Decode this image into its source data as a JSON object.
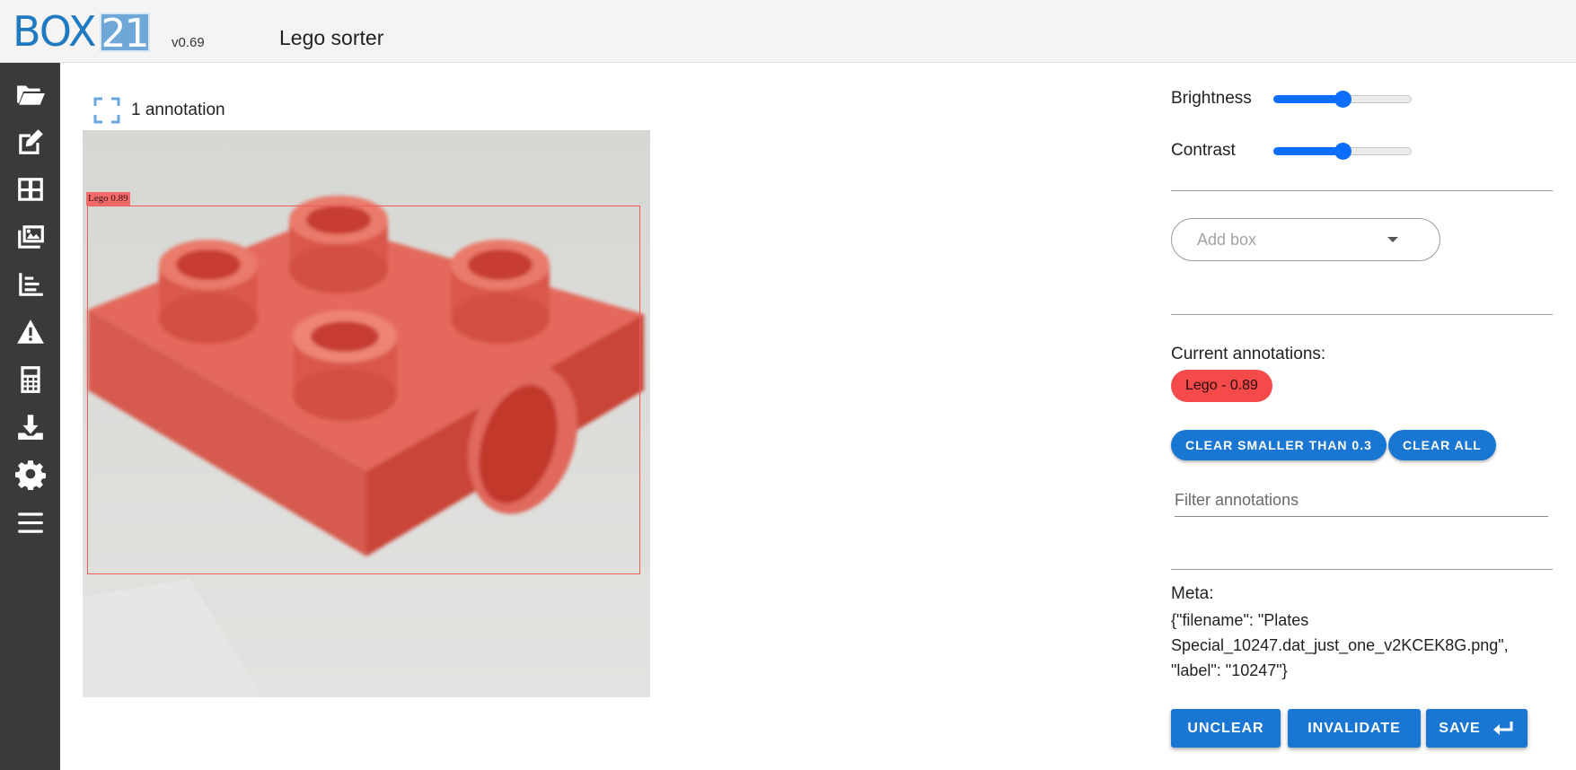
{
  "header": {
    "logo_text": "BOX",
    "logo_number": "21",
    "version": "v0.69",
    "title": "Lego sorter",
    "logo_colors": {
      "box": "#1f7ac2",
      "number_bg": "#6fa7d8"
    }
  },
  "sidebar": {
    "items": [
      {
        "name": "folder-open-icon"
      },
      {
        "name": "edit-icon"
      },
      {
        "name": "grid-icon"
      },
      {
        "name": "images-icon"
      },
      {
        "name": "chart-icon"
      },
      {
        "name": "warning-icon"
      },
      {
        "name": "calculator-icon"
      },
      {
        "name": "download-icon"
      },
      {
        "name": "settings-icon"
      },
      {
        "name": "menu-icon"
      }
    ]
  },
  "main": {
    "annotation_count": "1 annotation",
    "image": {
      "description_icon": "focus-icon",
      "bbox_label": "Lego 0.89",
      "bbox_color": "#f05a5a"
    }
  },
  "panel": {
    "brightness_label": "Brightness",
    "brightness_value": 0.5,
    "contrast_label": "Contrast",
    "contrast_value": 0.5,
    "add_box_placeholder": "Add box",
    "current_annotations_label": "Current annotations:",
    "annotations": [
      {
        "label": "Lego - 0.89",
        "color": "#f44a4a"
      }
    ],
    "clear_smaller_label": "CLEAR SMALLER THAN 0.3",
    "clear_all_label": "CLEAR ALL",
    "filter_placeholder": "Filter annotations",
    "meta_label": "Meta:",
    "meta_value": "{\"filename\": \"Plates Special_10247.dat_just_one_v2KCEK8G.png\", \"label\": \"10247\"}",
    "unclear_label": "UNCLEAR",
    "invalidate_label": "INVALIDATE",
    "save_label": "SAVE",
    "accent_color": "#1976d2"
  }
}
